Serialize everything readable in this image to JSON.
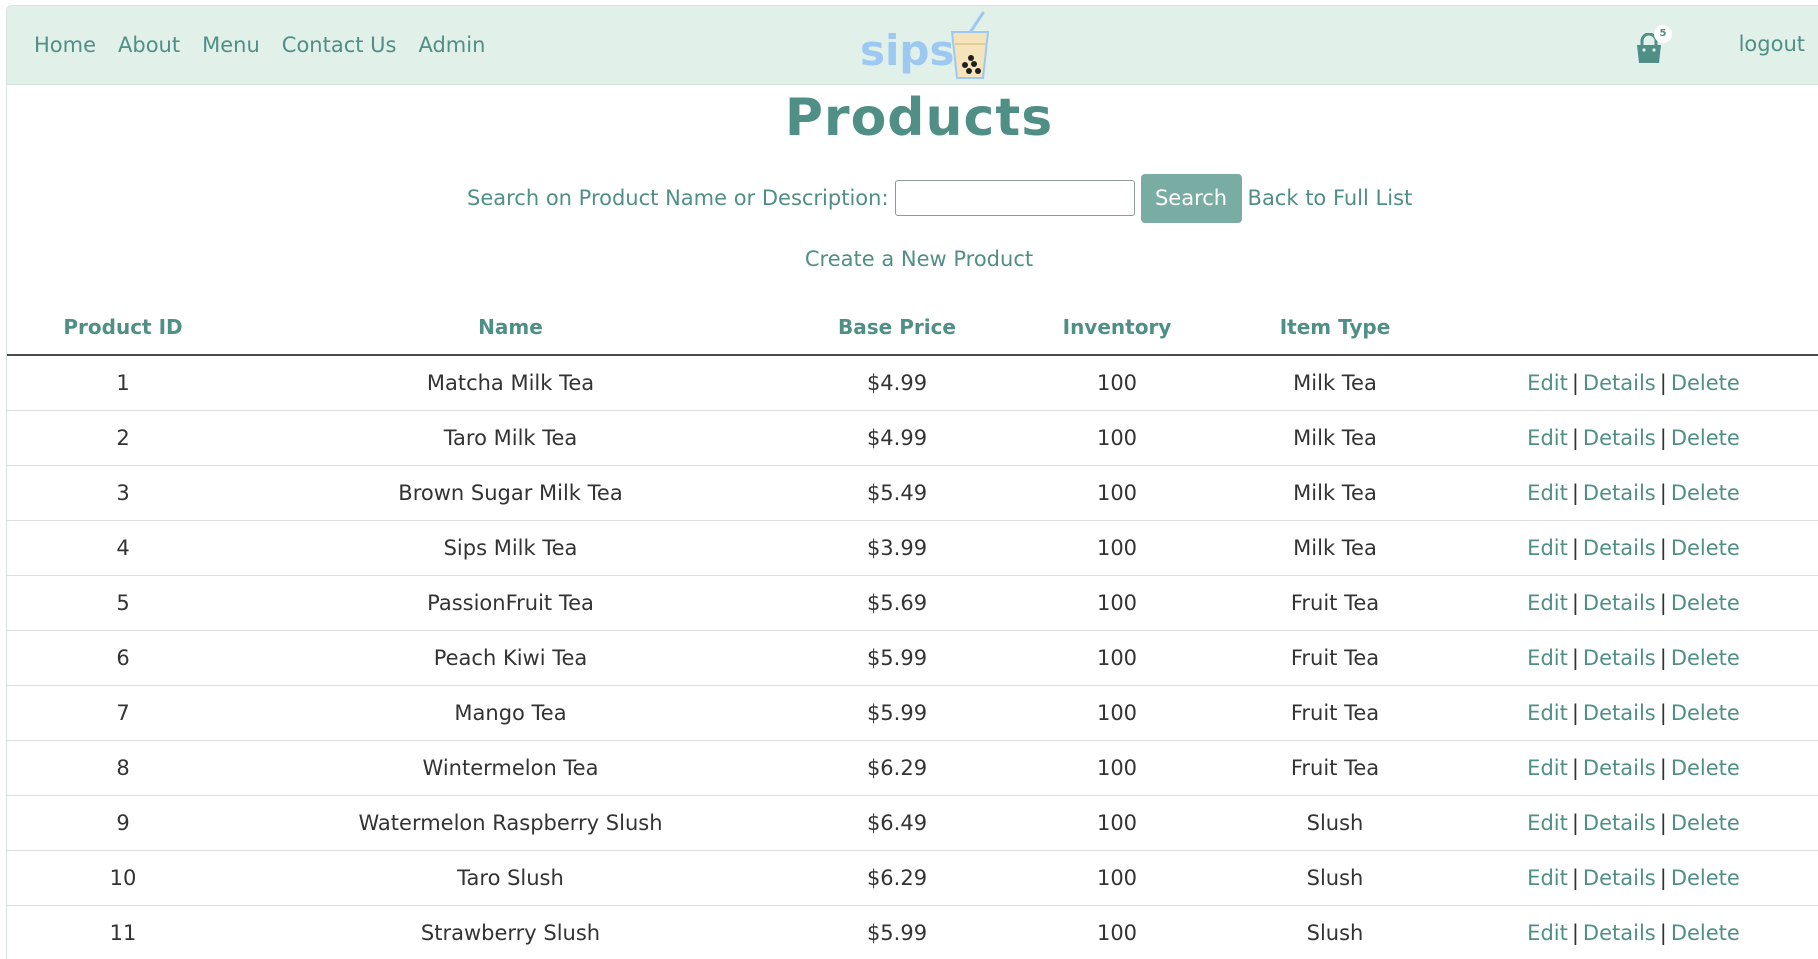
{
  "nav": {
    "links": [
      "Home",
      "About",
      "Menu",
      "Contact Us",
      "Admin"
    ],
    "logo_text": "sips",
    "cart_count": "5",
    "logout": "logout"
  },
  "page": {
    "title": "Products",
    "search_label": "Search on Product Name or Description:",
    "search_value": "",
    "search_button": "Search",
    "back_link": "Back to Full List",
    "create_link": "Create a New Product"
  },
  "table": {
    "headers": [
      "Product ID",
      "Name",
      "Base Price",
      "Inventory",
      "Item Type",
      ""
    ],
    "action_labels": {
      "edit": "Edit",
      "details": "Details",
      "delete": "Delete",
      "separator": "|"
    },
    "rows": [
      [
        "1",
        "Matcha Milk Tea",
        "$4.99",
        "100",
        "Milk Tea"
      ],
      [
        "2",
        "Taro Milk Tea",
        "$4.99",
        "100",
        "Milk Tea"
      ],
      [
        "3",
        "Brown Sugar Milk Tea",
        "$5.49",
        "100",
        "Milk Tea"
      ],
      [
        "4",
        "Sips Milk Tea",
        "$3.99",
        "100",
        "Milk Tea"
      ],
      [
        "5",
        "PassionFruit Tea",
        "$5.69",
        "100",
        "Fruit Tea"
      ],
      [
        "6",
        "Peach Kiwi Tea",
        "$5.99",
        "100",
        "Fruit Tea"
      ],
      [
        "7",
        "Mango Tea",
        "$5.99",
        "100",
        "Fruit Tea"
      ],
      [
        "8",
        "Wintermelon Tea",
        "$6.29",
        "100",
        "Fruit Tea"
      ],
      [
        "9",
        "Watermelon Raspberry Slush",
        "$6.49",
        "100",
        "Slush"
      ],
      [
        "10",
        "Taro Slush",
        "$6.29",
        "100",
        "Slush"
      ],
      [
        "11",
        "Strawberry Slush",
        "$5.99",
        "100",
        "Slush"
      ]
    ]
  },
  "colors": {
    "accent": "#4f8f86",
    "navbar_background": "#e2f0ea",
    "button_background": "#79ada3",
    "logo_blue": "#9cc8f2",
    "cup_fill": "#f5e3bb"
  },
  "icons": {
    "cart": "shopping-bag-icon",
    "logo_cup": "boba-cup-icon"
  }
}
